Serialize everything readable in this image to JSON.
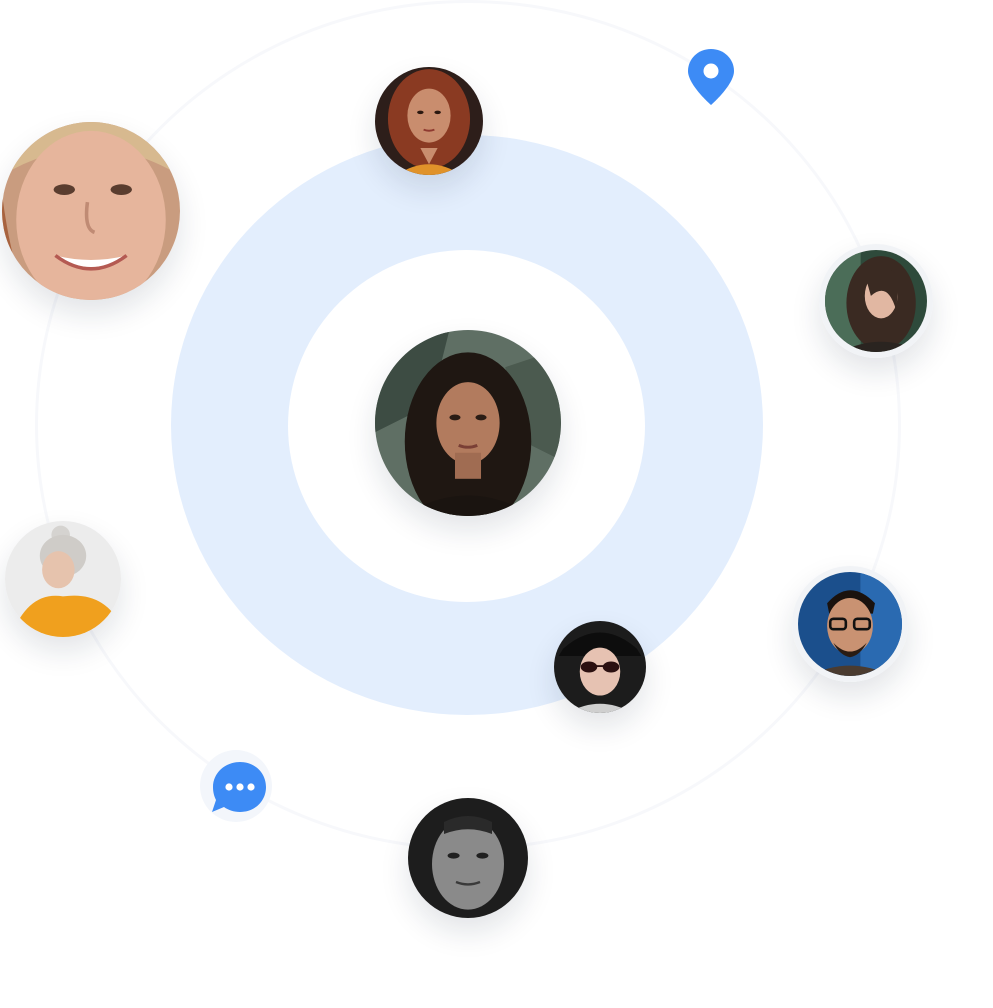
{
  "colors": {
    "accent": "#3d8bf5",
    "ring": "#e3eefd",
    "orbit": "#f7f8fb",
    "frame": "#f1f3f6"
  },
  "icons": {
    "pin": "location-pin-icon",
    "chat": "chat-bubble-icon"
  },
  "avatars": [
    "center-woman-avatar",
    "top-woman-avatar",
    "smiling-woman-avatar",
    "right-woman-avatar",
    "older-woman-avatar",
    "sunglasses-man-avatar",
    "glasses-man-avatar",
    "bottom-man-avatar"
  ]
}
